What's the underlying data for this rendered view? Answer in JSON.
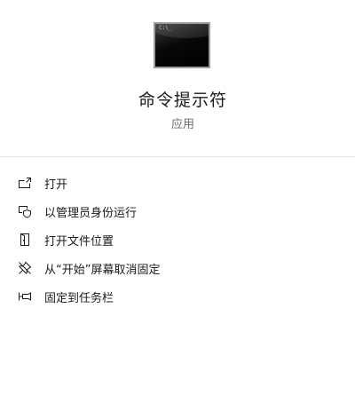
{
  "app": {
    "name": "命令提示符",
    "type": "应用",
    "icon": "command-prompt-icon",
    "icon_prompt_text": "C:\\_"
  },
  "menu": {
    "items": [
      {
        "label": "打开",
        "icon": "open-icon"
      },
      {
        "label": "以管理员身份运行",
        "icon": "shield-icon"
      },
      {
        "label": "打开文件位置",
        "icon": "file-location-icon"
      },
      {
        "label": "从“开始”屏幕取消固定",
        "icon": "unpin-icon"
      },
      {
        "label": "固定到任务栏",
        "icon": "pin-icon"
      }
    ]
  },
  "colors": {
    "background": "#ffffff",
    "text": "#1a1a1a",
    "subtext": "#6d6d6d",
    "divider": "#e6e6e6"
  }
}
